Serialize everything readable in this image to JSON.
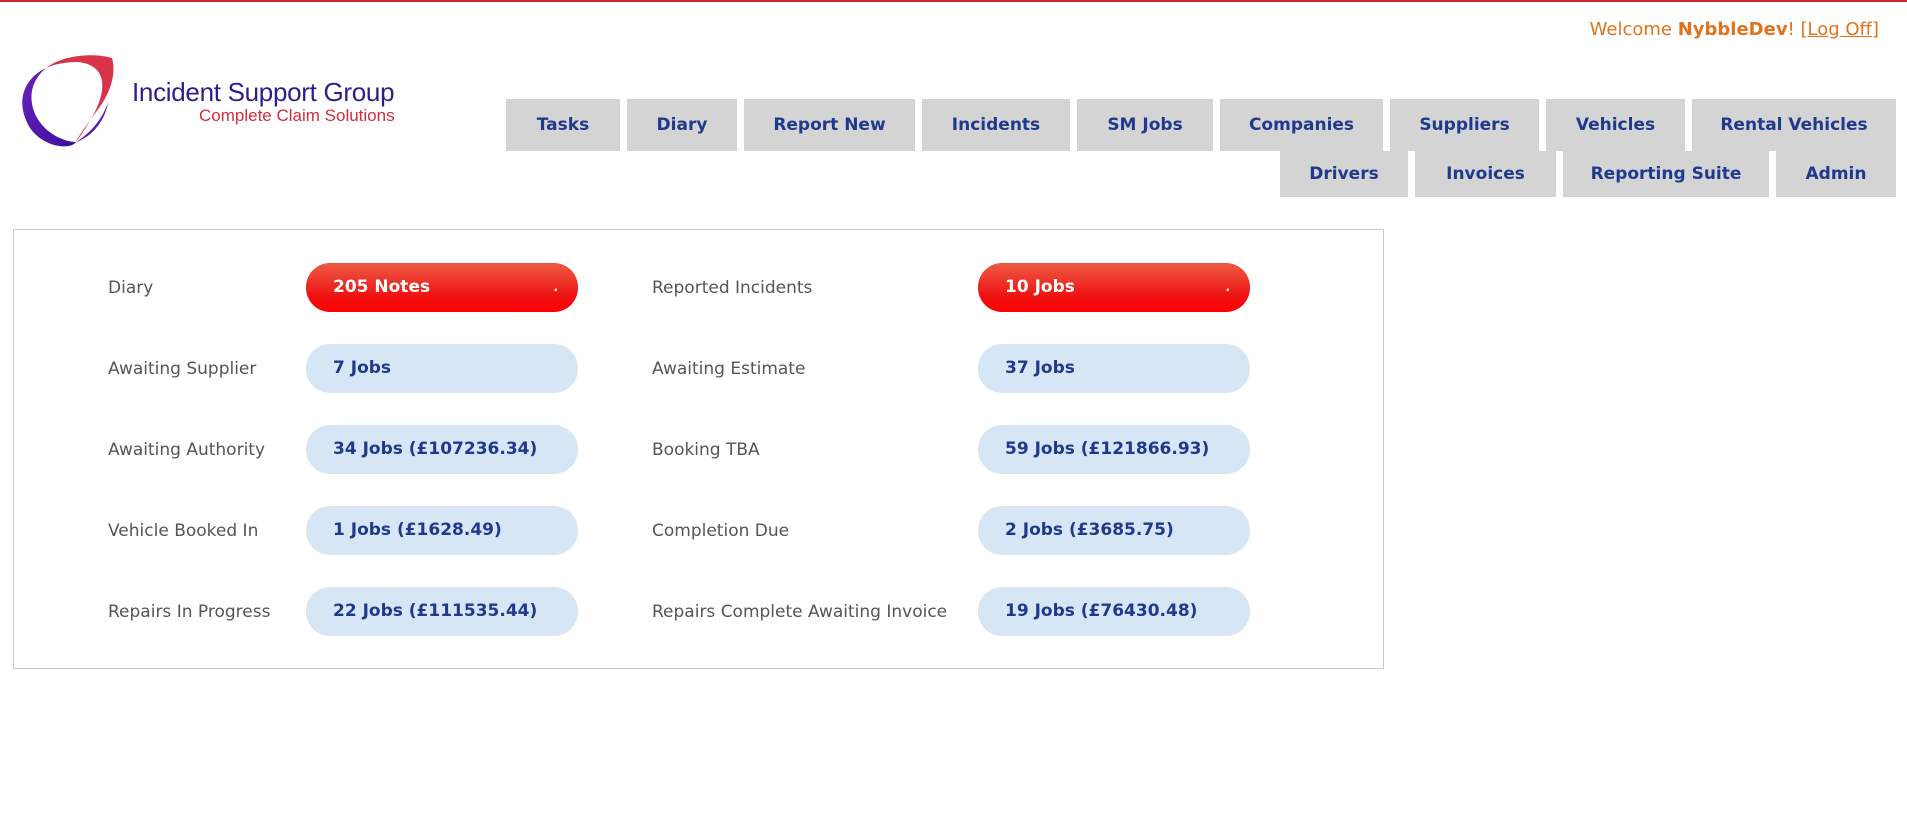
{
  "header": {
    "welcome_prefix": "Welcome ",
    "username": "NybbleDev",
    "welcome_suffix": "! ",
    "logoff_open": "[",
    "logoff_label": "Log Off",
    "logoff_close": "]"
  },
  "logo": {
    "name": "Incident Support Group",
    "tagline": "Complete Claim Solutions"
  },
  "nav": {
    "row1": [
      "Tasks",
      "Diary",
      "Report New",
      "Incidents",
      "SM Jobs",
      "Companies",
      "Suppliers",
      "Vehicles",
      "Rental Vehicles"
    ],
    "row2": [
      "Drivers",
      "Invoices",
      "Reporting Suite",
      "Admin"
    ]
  },
  "dashboard": {
    "left": [
      {
        "label": "Diary",
        "value": "205 Notes",
        "style": "red"
      },
      {
        "label": "Awaiting Supplier",
        "value": "7 Jobs",
        "style": "blue"
      },
      {
        "label": "Awaiting Authority",
        "value": "34 Jobs (£107236.34)",
        "style": "blue"
      },
      {
        "label": "Vehicle Booked In",
        "value": "1 Jobs (£1628.49)",
        "style": "blue"
      },
      {
        "label": "Repairs In Progress",
        "value": "22 Jobs (£111535.44)",
        "style": "blue"
      }
    ],
    "right": [
      {
        "label": "Reported Incidents",
        "value": "10 Jobs",
        "style": "red"
      },
      {
        "label": "Awaiting Estimate",
        "value": "37 Jobs",
        "style": "blue"
      },
      {
        "label": "Booking TBA",
        "value": "59 Jobs (£121866.93)",
        "style": "blue"
      },
      {
        "label": "Completion Due",
        "value": "2 Jobs (£3685.75)",
        "style": "blue"
      },
      {
        "label": "Repairs Complete Awaiting Invoice",
        "value": "19 Jobs (£76430.48)",
        "style": "blue"
      }
    ],
    "red_marker": "."
  },
  "colors": {
    "accent_orange": "#e0731c",
    "nav_text": "#1f3a8c",
    "nav_bg": "#d4d4d4",
    "alert_red": "#f01010",
    "pill_blue": "#d6e6f4",
    "top_border": "#c8262e"
  }
}
